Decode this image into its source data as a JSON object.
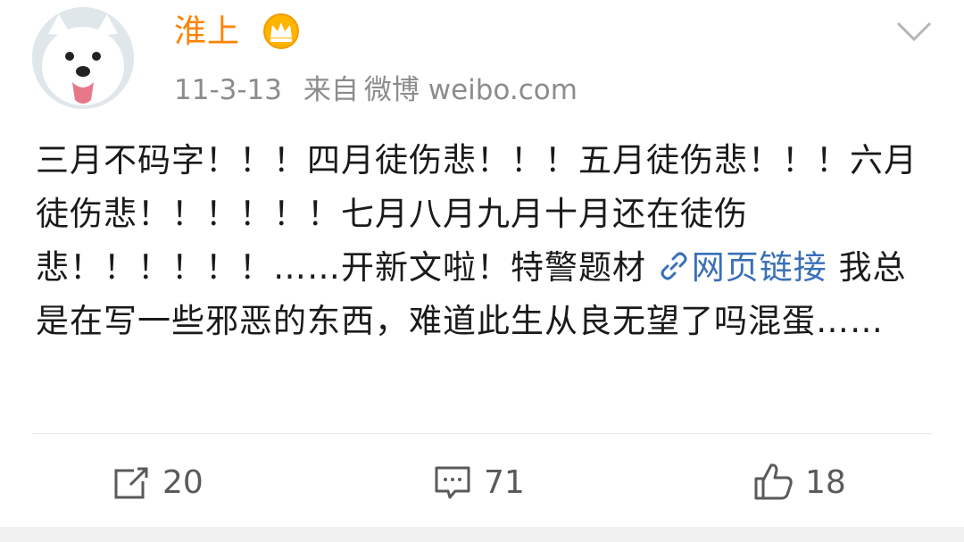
{
  "post": {
    "username": "淮上",
    "date": "11-3-13",
    "source_prefix": "来自",
    "source": "微博 weibo.com",
    "text_before_link": "三月不码字！！！四月徒伤悲！！！五月徒伤悲！！！六月徒伤悲！！！！！！七月八月九月十月还在徒伤悲！！！！！！……开新文啦！特警题材",
    "link_label": "网页链接",
    "text_after_link": " 我总是在写一些邪恶的东西，难道此生从良无望了吗混蛋……"
  },
  "actions": {
    "repost_count": "20",
    "comment_count": "71",
    "like_count": "18"
  },
  "colors": {
    "username": "#ff8200",
    "link": "#3a6fb8",
    "meta": "#8c8c8c"
  }
}
